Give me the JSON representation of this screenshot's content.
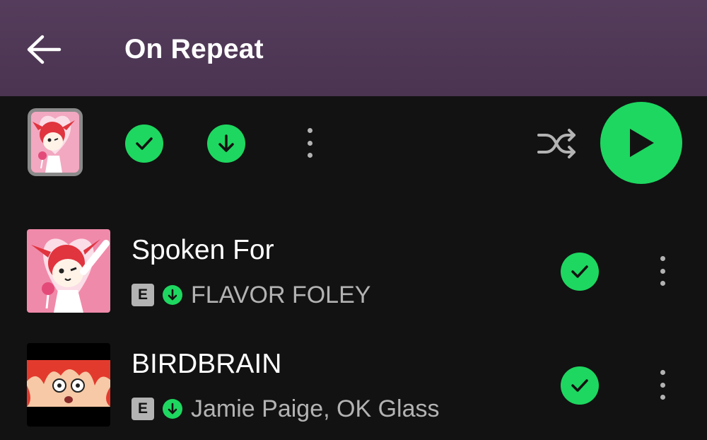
{
  "header": {
    "title": "On Repeat",
    "background": "#553c5c"
  },
  "actions": {
    "added_icon": "check-circle-icon",
    "downloaded_icon": "download-circle-icon",
    "more_icon": "more-vertical-icon",
    "shuffle_icon": "shuffle-icon",
    "play_icon": "play-icon"
  },
  "tracks": [
    {
      "title": "Spoken For",
      "explicit_label": "E",
      "artist": "FLAVOR FOLEY",
      "downloaded": true,
      "liked": true
    },
    {
      "title": "BIRDBRAIN",
      "explicit_label": "E",
      "artist": "Jamie Paige, OK Glass",
      "downloaded": true,
      "liked": true
    }
  ],
  "colors": {
    "accent": "#1ed760",
    "background": "#121212",
    "secondary_text": "#b3b3b3"
  }
}
